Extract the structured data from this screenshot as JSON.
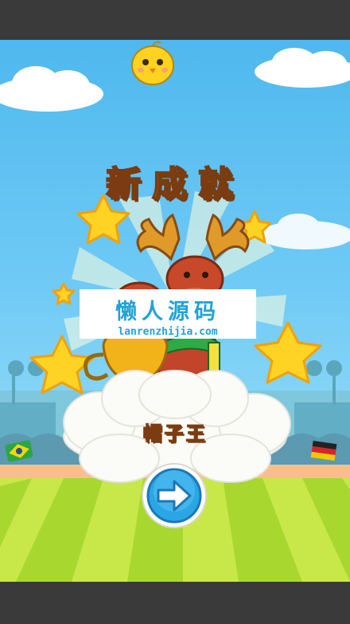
{
  "screen": {
    "title": "新成就",
    "achievement_name": "帽子王",
    "next_button_icon": "arrow-right-icon"
  },
  "watermark": {
    "title": "懒人源码",
    "url": "lanrenzhijia.com"
  },
  "colors": {
    "sky": "#5cc0f0",
    "grass_light": "#c8e84a",
    "grass_dark": "#a8d830",
    "title_text": "#fff2cf",
    "title_outline": "#7a3c10",
    "achievement_text": "#f4a72b",
    "button_blue": "#2ba6e4"
  }
}
